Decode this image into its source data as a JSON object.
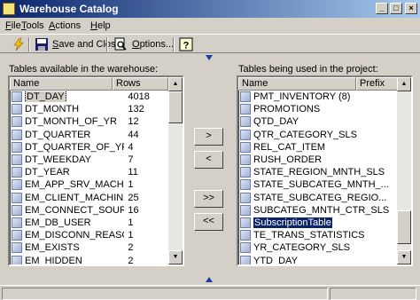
{
  "window": {
    "title": "Warehouse Catalog"
  },
  "menu": [
    {
      "u": "F",
      "rest": "ile"
    },
    {
      "u": "T",
      "rest": "ools"
    },
    {
      "u": "A",
      "rest": "ctions"
    },
    {
      "u": "H",
      "rest": "elp"
    }
  ],
  "toolbar": {
    "save_close_u": "S",
    "save_close_rest": "ave and Close",
    "options_u": "O",
    "options_rest": "ptions..."
  },
  "left_panel": {
    "label": "Tables available in the warehouse:",
    "col_name": "Name",
    "col_rows": "Rows",
    "rows": [
      {
        "name": "DT_DAY",
        "rows": "4018"
      },
      {
        "name": "DT_MONTH",
        "rows": "132"
      },
      {
        "name": "DT_MONTH_OF_YR",
        "rows": "12"
      },
      {
        "name": "DT_QUARTER",
        "rows": "44"
      },
      {
        "name": "DT_QUARTER_OF_YR",
        "rows": "4"
      },
      {
        "name": "DT_WEEKDAY",
        "rows": "7"
      },
      {
        "name": "DT_YEAR",
        "rows": "11"
      },
      {
        "name": "EM_APP_SRV_MACHINE",
        "rows": "1"
      },
      {
        "name": "EM_CLIENT_MACHINE",
        "rows": "25"
      },
      {
        "name": "EM_CONNECT_SOURCE",
        "rows": "16"
      },
      {
        "name": "EM_DB_USER",
        "rows": "1"
      },
      {
        "name": "EM_DISCONN_REASON",
        "rows": "1"
      },
      {
        "name": "EM_EXISTS",
        "rows": "2"
      },
      {
        "name": "EM_HIDDEN",
        "rows": "2"
      }
    ]
  },
  "right_panel": {
    "label": "Tables being used in the project:",
    "col_name": "Name",
    "col_prefix": "Prefix",
    "rows": [
      {
        "name": "PMT_INVENTORY (8)"
      },
      {
        "name": "PROMOTIONS"
      },
      {
        "name": "QTD_DAY"
      },
      {
        "name": "QTR_CATEGORY_SLS"
      },
      {
        "name": "REL_CAT_ITEM"
      },
      {
        "name": "RUSH_ORDER"
      },
      {
        "name": "STATE_REGION_MNTH_SLS"
      },
      {
        "name": "STATE_SUBCATEG_MNTH_..."
      },
      {
        "name": "STATE_SUBCATEG_REGIO..."
      },
      {
        "name": "SUBCATEG_MNTH_CTR_SLS"
      },
      {
        "name": "SubscriptionTable"
      },
      {
        "name": "TE_TRANS_STATISTICS"
      },
      {
        "name": "YR_CATEGORY_SLS"
      },
      {
        "name": "YTD_DAY"
      }
    ]
  },
  "buttons": {
    "add_one": ">",
    "remove_one": "<",
    "add_all": ">>",
    "remove_all": "<<"
  },
  "colors": {
    "title_start": "#0a246a",
    "title_end": "#a6caf0",
    "selection": "#0a246a",
    "face": "#d4d0c8"
  }
}
